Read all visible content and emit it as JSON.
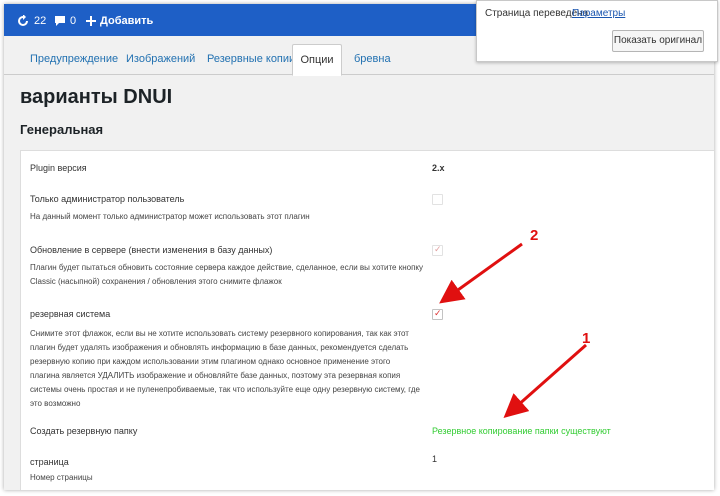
{
  "adminbar": {
    "updates_count": "22",
    "comments_count": "0",
    "add_label": "Добавить",
    "bg_color": "#1e5fc6"
  },
  "translate_popup": {
    "message": "Страница переведена",
    "params_link": "Параметры",
    "show_original": "Показать оригинал"
  },
  "tabs": [
    {
      "label": "Предупреждение",
      "active": false
    },
    {
      "label": "Изображений",
      "active": false
    },
    {
      "label": "Резервные копии",
      "active": false
    },
    {
      "label": "Опции",
      "active": true
    },
    {
      "label": "бревна",
      "active": false
    }
  ],
  "page": {
    "title": "варианты DNUI",
    "section_title": "Генеральная"
  },
  "settings": {
    "plugin_version_label": "Plugin версия",
    "plugin_version_value": "2.x",
    "admin_only_label": "Только администратор пользователь",
    "admin_only_desc": "На данный момент только администратор может использовать этот плагин",
    "admin_only_checked": false,
    "server_update_label": "Обновление в сервере (внести изменения в базу данных)",
    "server_update_desc_1": "Плагин будет пытаться обновить состояние сервера каждое действие, сделанное, если вы хотите кнопку",
    "server_update_desc_2": "Classic (насыпной) сохранения / обновления этого снимите флажок",
    "server_update_checked": true,
    "backup_system_label": "резервная система",
    "backup_system_desc": [
      "Снимите этот флажок, если вы не хотите использовать систему резервного копирования, так как этот",
      "плагин будет удалять изображения и обновлять информацию в базе данных, рекомендуется сделать",
      "резервную копию при каждом использовании этим плагином однако основное применение этого",
      "плагина является УДАЛИТЬ изображение и обновляйте базе данных, поэтому эта резервная копия",
      "системы очень простая и не пуленепробиваемые, так что используйте еще одну резервную систему, где",
      "это возможно"
    ],
    "backup_system_checked": true,
    "create_backup_folder_label": "Создать резервную папку",
    "create_backup_folder_value": "Резервное копирование папки существуют",
    "page_label": "страница",
    "page_value": "1",
    "page_number_label": "Номер страницы"
  },
  "annotations": {
    "marker_1": "1",
    "marker_2": "2",
    "arrow_color": "#e01010"
  }
}
